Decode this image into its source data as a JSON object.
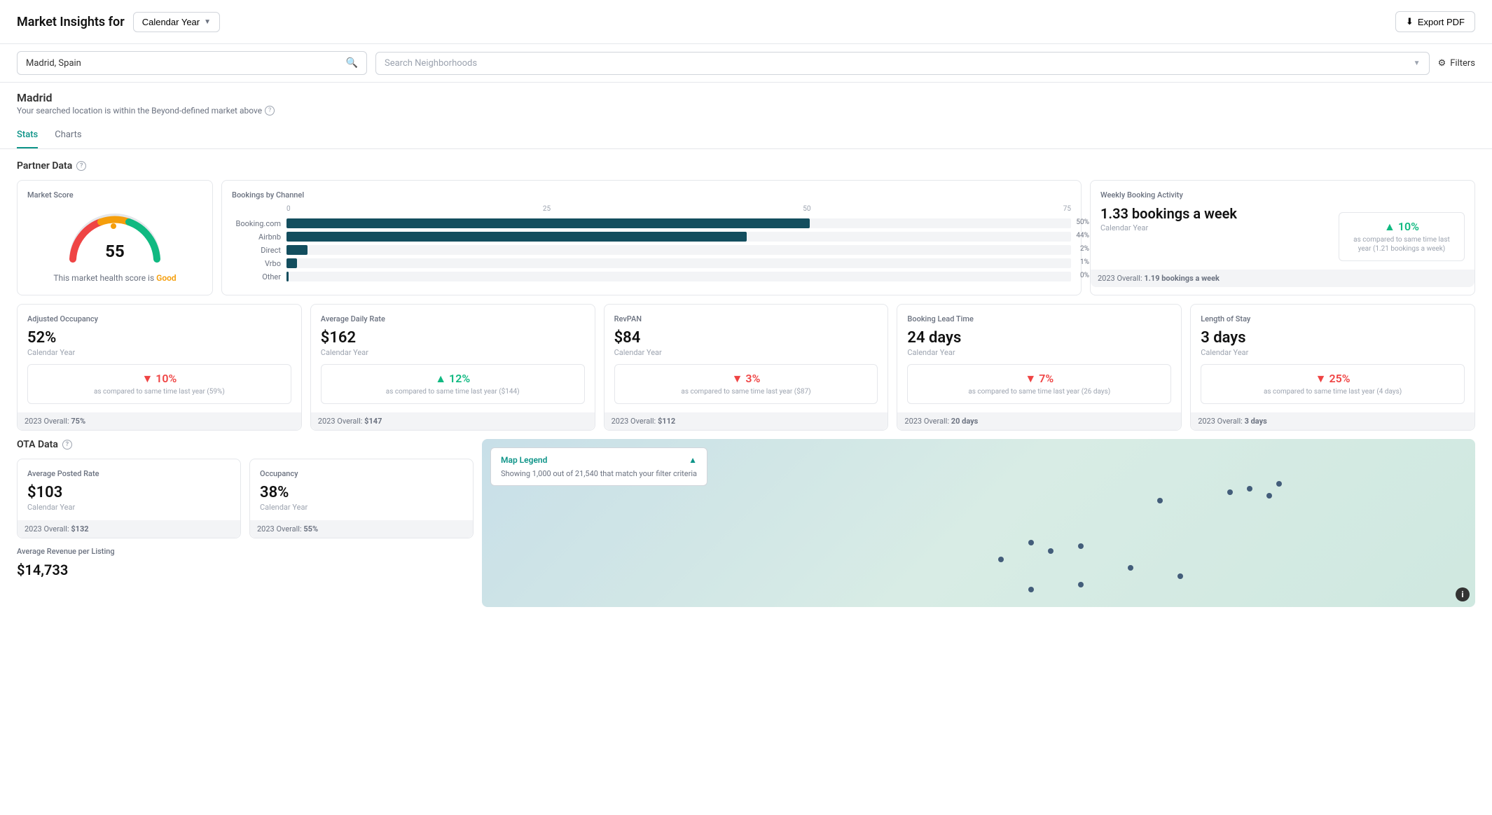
{
  "header": {
    "title": "Market Insights for",
    "dropdown_label": "Calendar Year",
    "export_label": "Export PDF"
  },
  "search": {
    "location_value": "Madrid, Spain",
    "location_placeholder": "Madrid, Spain",
    "neighborhoods_placeholder": "Search Neighborhoods",
    "filters_label": "Filters"
  },
  "location": {
    "name": "Madrid",
    "sub_text": "Your searched location is within the Beyond-defined market above"
  },
  "tabs": [
    {
      "label": "Stats",
      "active": true
    },
    {
      "label": "Charts",
      "active": false
    }
  ],
  "partner_data": {
    "section_label": "Partner Data",
    "market_score": {
      "title": "Market Score",
      "score": "55",
      "description": "This market health score is",
      "rating": "Good"
    },
    "bookings_by_channel": {
      "title": "Bookings by Channel",
      "axis": [
        "0",
        "25",
        "50",
        "75"
      ],
      "channels": [
        {
          "name": "Booking.com",
          "pct": 50,
          "label": "50%"
        },
        {
          "name": "Airbnb",
          "pct": 44,
          "label": "44%"
        },
        {
          "name": "Direct",
          "pct": 2,
          "label": "2%"
        },
        {
          "name": "Vrbo",
          "pct": 1,
          "label": "1%"
        },
        {
          "name": "Other",
          "pct": 0,
          "label": "0%"
        }
      ]
    },
    "weekly_booking": {
      "title": "Weekly Booking Activity",
      "value": "1.33 bookings a week",
      "sub": "Calendar Year",
      "compare_pct": "10%",
      "compare_dir": "up",
      "compare_label": "as compared to same time last year (1.21 bookings a week)",
      "overall_label": "2023 Overall:",
      "overall_value": "1.19 bookings a week"
    },
    "adjusted_occupancy": {
      "title": "Adjusted Occupancy",
      "value": "52%",
      "sub": "Calendar Year",
      "compare_pct": "10%",
      "compare_dir": "down",
      "compare_label": "as compared to same time last year (59%)",
      "overall_label": "2023 Overall:",
      "overall_value": "75%"
    },
    "avg_daily_rate": {
      "title": "Average Daily Rate",
      "value": "$162",
      "sub": "Calendar Year",
      "compare_pct": "12%",
      "compare_dir": "up",
      "compare_label": "as compared to same time last year ($144)",
      "overall_label": "2023 Overall:",
      "overall_value": "$147"
    },
    "revpan": {
      "title": "RevPAN",
      "value": "$84",
      "sub": "Calendar Year",
      "compare_pct": "3%",
      "compare_dir": "down",
      "compare_label": "as compared to same time last year ($87)",
      "overall_label": "2023 Overall:",
      "overall_value": "$112"
    },
    "booking_lead_time": {
      "title": "Booking Lead Time",
      "value": "24 days",
      "sub": "Calendar Year",
      "compare_pct": "7%",
      "compare_dir": "down",
      "compare_label": "as compared to same time last year (26 days)",
      "overall_label": "2023 Overall:",
      "overall_value": "20 days"
    },
    "length_of_stay": {
      "title": "Length of Stay",
      "value": "3 days",
      "sub": "Calendar Year",
      "compare_pct": "25%",
      "compare_dir": "down",
      "compare_label": "as compared to same time last year (4 days)",
      "overall_label": "2023 Overall:",
      "overall_value": "3 days"
    }
  },
  "ota_data": {
    "section_label": "OTA Data",
    "avg_posted_rate": {
      "title": "Average Posted Rate",
      "value": "$103",
      "sub": "Calendar Year",
      "overall_label": "2023 Overall:",
      "overall_value": "$132"
    },
    "occupancy": {
      "title": "Occupancy",
      "value": "38%",
      "sub": "Calendar Year",
      "overall_label": "2023 Overall:",
      "overall_value": "55%"
    },
    "avg_revenue": {
      "title": "Average Revenue per Listing",
      "value": "$14,733"
    }
  },
  "map": {
    "legend_title": "Map Legend",
    "legend_text": "Showing 1,000 out of 21,540 that match your filter criteria"
  }
}
